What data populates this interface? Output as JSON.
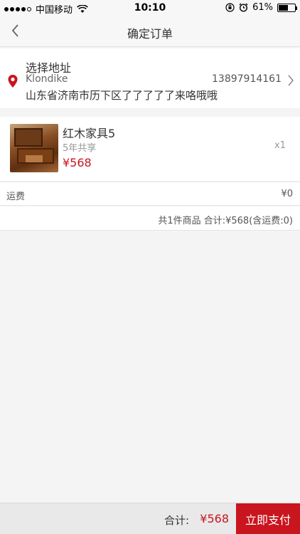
{
  "status_bar": {
    "carrier": "中国移动",
    "time": "10:10",
    "battery": "61%",
    "battery_level": 0.61
  },
  "nav": {
    "title": "确定订单"
  },
  "address": {
    "title": "选择地址",
    "name": "Klondike",
    "phone": "13897914161",
    "detail": "山东省济南市历下区了了了了了来咯哦哦"
  },
  "product": {
    "name": "红木家具5",
    "description": "5年共享",
    "price": "¥568",
    "quantity": "x1"
  },
  "shipping": {
    "label": "运费",
    "value": "¥0"
  },
  "summary": {
    "text": "共1件商品 合计:¥568(含运费:0)"
  },
  "bottom_bar": {
    "total_label": "合计:",
    "total_amount": "¥568",
    "pay_button": "立即支付"
  },
  "colors": {
    "accent": "#c9151e"
  }
}
